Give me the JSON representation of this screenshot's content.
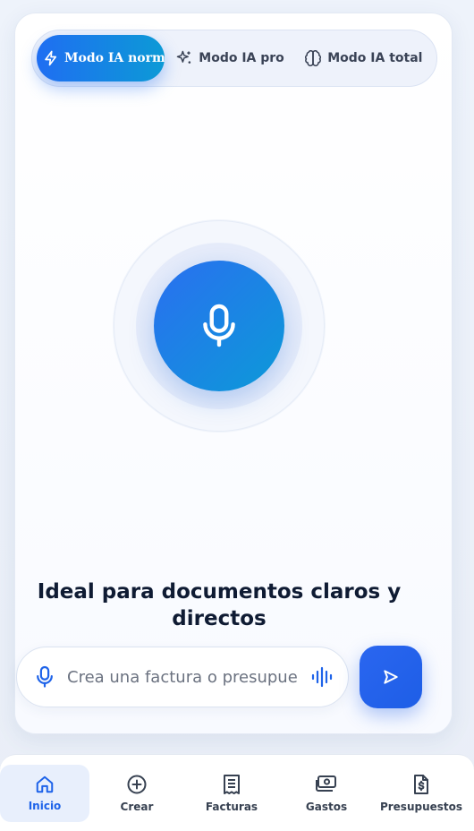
{
  "modes": {
    "normal": {
      "label": "Modo IA normal",
      "icon": "bolt-icon",
      "active": true
    },
    "pro": {
      "label": "Modo IA pro",
      "icon": "sparkles-icon"
    },
    "total": {
      "label": "Modo IA total",
      "icon": "brain-icon"
    }
  },
  "voice": {
    "icon": "microphone-icon"
  },
  "tagline": "Ideal para documentos claros y directos",
  "composer": {
    "placeholder": "Crea una factura o presupuesto...",
    "value": "",
    "mic_icon": "microphone-icon",
    "wave_icon": "audio-waveform-icon",
    "send_icon": "send-icon"
  },
  "nav": [
    {
      "label": "Inicio",
      "icon": "home-icon",
      "active": true
    },
    {
      "label": "Crear",
      "icon": "plus-circle-icon"
    },
    {
      "label": "Facturas",
      "icon": "receipt-icon"
    },
    {
      "label": "Gastos",
      "icon": "banknote-icon"
    },
    {
      "label": "Presupuestos",
      "icon": "dollar-document-icon"
    }
  ],
  "colors": {
    "accent": "#1f6ef2",
    "accent_secondary": "#0c9ad6",
    "text_dark": "#0f1b33",
    "nav_active_bg": "#e8effc"
  }
}
